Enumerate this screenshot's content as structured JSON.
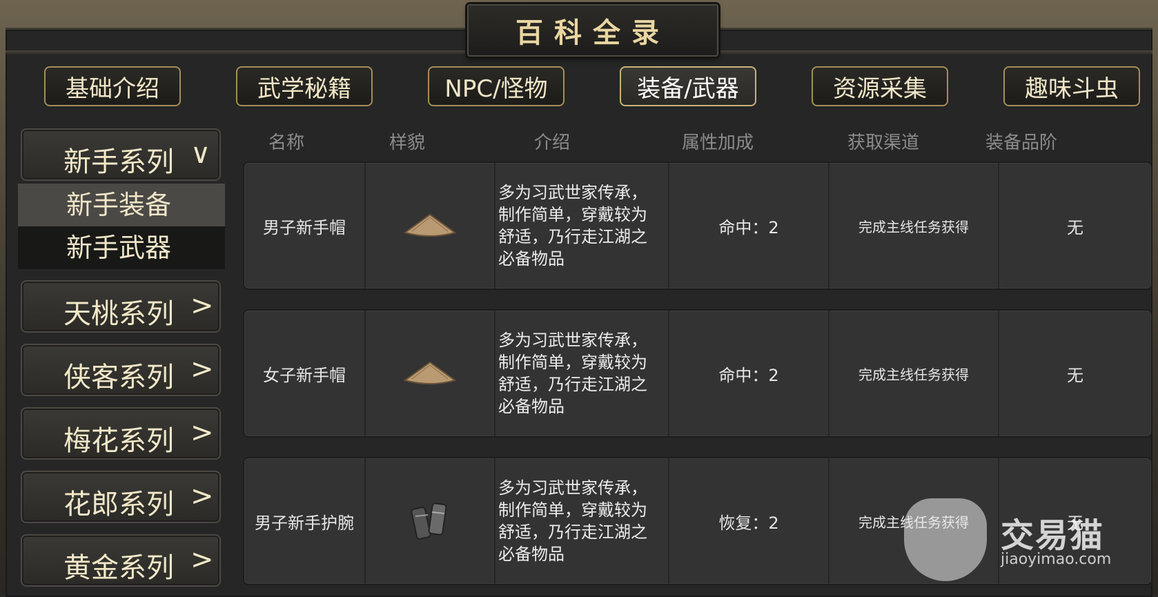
{
  "title": "百科全录",
  "tabs": [
    {
      "label": "基础介绍",
      "active": false
    },
    {
      "label": "武学秘籍",
      "active": false
    },
    {
      "label": "NPC/怪物",
      "active": false
    },
    {
      "label": "装备/武器",
      "active": true
    },
    {
      "label": "资源采集",
      "active": false
    },
    {
      "label": "趣味斗虫",
      "active": false
    }
  ],
  "sidebar": {
    "expanded": {
      "label": "新手系列",
      "chevron": "∨",
      "subitems": [
        "新手装备",
        "新手武器"
      ]
    },
    "series": [
      "天桃系列",
      "侠客系列",
      "梅花系列",
      "花郎系列",
      "黄金系列"
    ],
    "chevron": ">"
  },
  "columns": [
    "名称",
    "样貌",
    "介绍",
    "属性加成",
    "获取渠道",
    "装备品阶"
  ],
  "rows": [
    {
      "name": "男子新手帽",
      "icon": "straw-hat-icon",
      "desc": "多为习武世家传承，制作简单，穿戴较为舒适，乃行走江湖之必备物品",
      "attr": "命中：2",
      "source": "完成主线任务获得",
      "tier": "无"
    },
    {
      "name": "女子新手帽",
      "icon": "straw-hat-icon",
      "desc": "多为习武世家传承，制作简单，穿戴较为舒适，乃行走江湖之必备物品",
      "attr": "命中：2",
      "source": "完成主线任务获得",
      "tier": "无"
    },
    {
      "name": "男子新手护腕",
      "icon": "bracer-icon",
      "desc": "多为习武世家传承，制作简单，穿戴较为舒适，乃行走江湖之必备物品",
      "attr": "恢复：2",
      "source": "完成主线任务获得",
      "tier": "无"
    }
  ],
  "watermark": {
    "text": "交易猫",
    "url": "jiaoyimao.com"
  }
}
